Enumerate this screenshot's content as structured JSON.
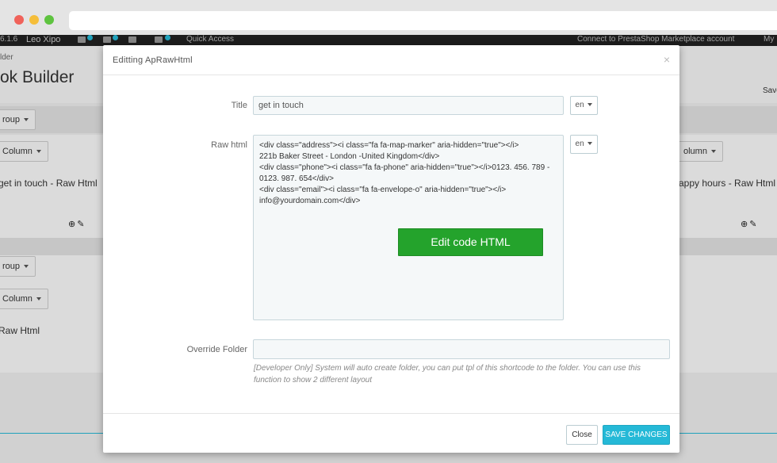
{
  "topbar": {
    "version": "6.1.6",
    "shop_name": "Leo Xipo",
    "quick_access": "Quick Access",
    "marketplace": "Connect to PrestaShop Marketplace account",
    "my": "My"
  },
  "background": {
    "breadcrumb": "lder",
    "page_title": "ok Builder",
    "save_text": "Save",
    "group_label": "roup",
    "column_label": "Column",
    "column_label_right": "olumn",
    "block_left": "get in touch - Raw Html",
    "block_right": "appy hours - Raw Html",
    "group_label_2": "roup",
    "column_label_2": "Column",
    "block_left_2": "Raw Html"
  },
  "modal": {
    "title": "Editting ApRawHtml",
    "close_glyph": "×",
    "fields": {
      "title_label": "Title",
      "title_value": "get in touch",
      "lang": "en",
      "raw_label": "Raw html",
      "raw_lines": [
        "<div class=\"address\"><i class=\"fa fa-map-marker\" aria-hidden=\"true\"></i>",
        "221b Baker Street - London  -United Kingdom</div>",
        "<div class=\"phone\"><i class=\"fa fa-phone\" aria-hidden=\"true\"></i>0123. 456. 789 -",
        "0123. 987. 654</div>",
        "<div class=\"email\"><i class=\"fa fa-envelope-o\" aria-hidden=\"true\"></i>",
        "info@yourdomain.com</div>"
      ],
      "edit_code_label": "Edit code HTML",
      "override_label": "Override Folder",
      "override_value": "",
      "help_text": "[Developer Only] System will auto create folder, you can put tpl of this shortcode to the folder. You can use this function to show 2 different layout"
    },
    "footer": {
      "close_label": "Close",
      "save_label": "SAVE CHANGES"
    }
  },
  "colors": {
    "primary": "#25b9d7",
    "success": "#24a32c"
  }
}
